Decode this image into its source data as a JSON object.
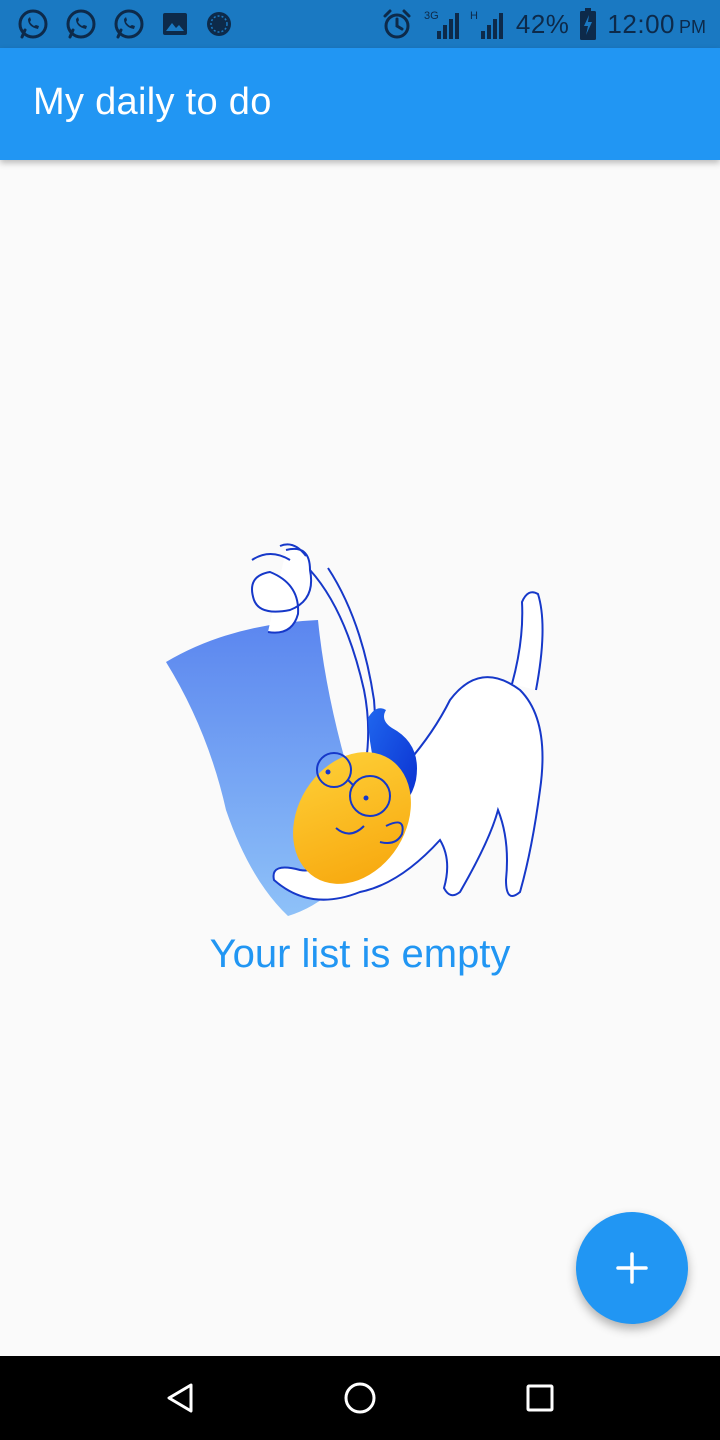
{
  "status_bar": {
    "notifications": [
      "whatsapp-icon",
      "whatsapp-icon",
      "whatsapp-icon",
      "image-icon",
      "circle-app-icon"
    ],
    "indicators": [
      "alarm-icon",
      "signal-3g-icon",
      "signal-h-icon"
    ],
    "network_1": "3G",
    "network_2": "H",
    "battery": "42%",
    "time": "12:00",
    "ampm": "PM",
    "background_color": "#1a79c2"
  },
  "app_bar": {
    "title": "My daily to do",
    "color": "#2196f3"
  },
  "empty_state": {
    "illustration": "person-stretching-illustration",
    "message": "Your list is empty"
  },
  "fab": {
    "icon": "plus-icon",
    "color": "#2196f3"
  },
  "nav_bar": {
    "buttons": [
      "back-icon",
      "home-icon",
      "recents-icon"
    ]
  }
}
